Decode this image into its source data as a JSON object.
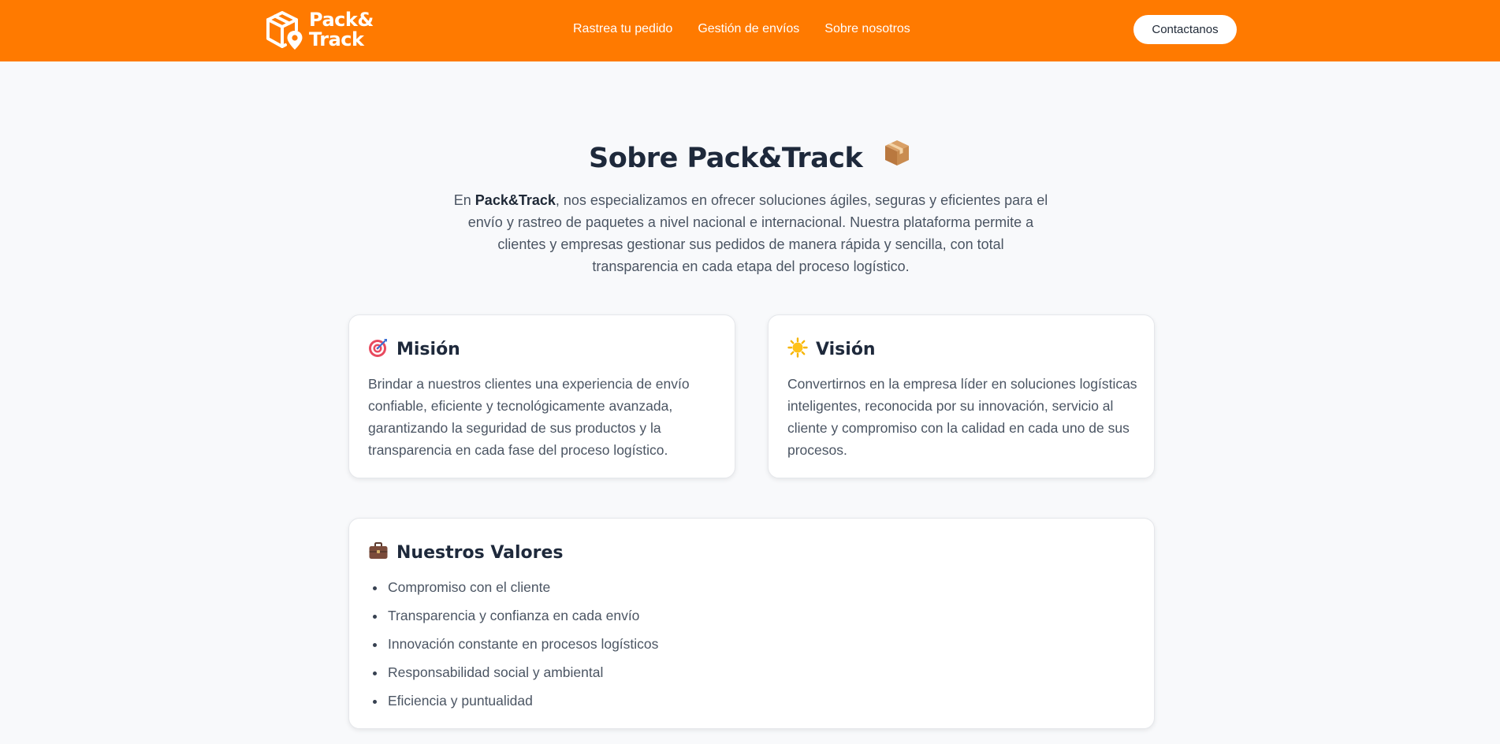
{
  "brand": {
    "line1": "Pack&",
    "line2": "Track",
    "color": "#ff7a00"
  },
  "nav": {
    "links": [
      "Rastrea tu pedido",
      "Gestión de envíos",
      "Sobre nosotros"
    ],
    "contact_label": "Contactanos"
  },
  "hero": {
    "title": "Sobre Pack&Track",
    "title_icon": "package-icon",
    "intro_prefix": "En ",
    "intro_brand": "Pack&Track",
    "intro_rest": ", nos especializamos en ofrecer soluciones ágiles, seguras y eficientes para el envío y rastreo de paquetes a nivel nacional e internacional. Nuestra plataforma permite a clientes y empresas gestionar sus pedidos de manera rápida y sencilla, con total transparencia en cada etapa del proceso logístico."
  },
  "mision": {
    "icon": "target-icon",
    "title": "Misión",
    "text": "Brindar a nuestros clientes una experiencia de envío confiable, eficiente y tecnológicamente avanzada, garantizando la seguridad de sus productos y la transparencia en cada fase del proceso logístico."
  },
  "vision": {
    "icon": "sun-icon",
    "title": "Visión",
    "text": "Convertirnos en la empresa líder en soluciones logísticas inteligentes, reconocida por su innovación, servicio al cliente y compromiso con la calidad en cada uno de sus procesos."
  },
  "valores": {
    "icon": "briefcase-icon",
    "title": "Nuestros Valores",
    "items": [
      "Compromiso con el cliente",
      "Transparencia y confianza en cada envío",
      "Innovación constante en procesos logísticos",
      "Responsabilidad social y ambiental",
      "Eficiencia y puntualidad"
    ]
  }
}
